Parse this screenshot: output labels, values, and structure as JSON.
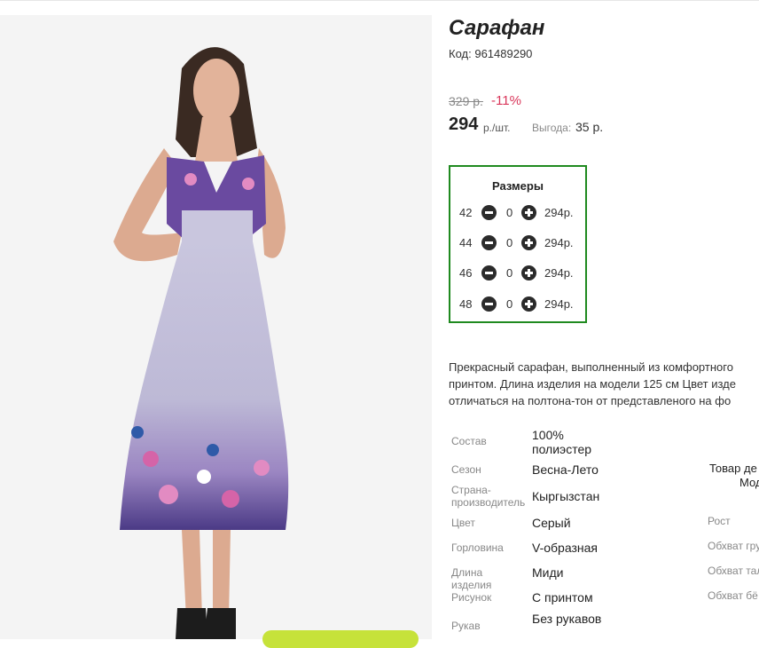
{
  "product": {
    "title": "Сарафан",
    "code_label": "Код:",
    "code_value": "961489290",
    "old_price": "329 р.",
    "discount": "-11%",
    "price": "294",
    "price_unit": "р./шт.",
    "savings_label": "Выгода:",
    "savings_value": "35 р."
  },
  "sizes": {
    "title": "Размеры",
    "rows": [
      {
        "size": "42",
        "qty": "0",
        "price": "294р."
      },
      {
        "size": "44",
        "qty": "0",
        "price": "294р."
      },
      {
        "size": "46",
        "qty": "0",
        "price": "294р."
      },
      {
        "size": "48",
        "qty": "0",
        "price": "294р."
      }
    ]
  },
  "description": {
    "line1": "Прекрасный сарафан, выполненный из комфортного",
    "line2": "принтом. Длина изделия на модели 125 см Цвет изде",
    "line3": "отличаться на полтона-тон от представленого на фо"
  },
  "attributes": [
    {
      "label": "Состав",
      "value": "100% полиэстер"
    },
    {
      "label": "Сезон",
      "value": "Весна-Лето"
    },
    {
      "label": "Страна-производитель",
      "value": "Кыргызстан"
    },
    {
      "label": "Цвет",
      "value": "Серый"
    },
    {
      "label": "Горловина",
      "value": "V-образная"
    },
    {
      "label": "Длина изделия",
      "value": "Миди"
    },
    {
      "label": "Рисунок",
      "value": "С принтом"
    },
    {
      "label": "Рукав",
      "value": "Без рукавов"
    }
  ],
  "side_panel": {
    "note_line1": "Товар де",
    "note_line2": "Мод",
    "measurements": [
      "Рост",
      "Обхват гру",
      "Обхват тал",
      "Обхват бё"
    ]
  }
}
